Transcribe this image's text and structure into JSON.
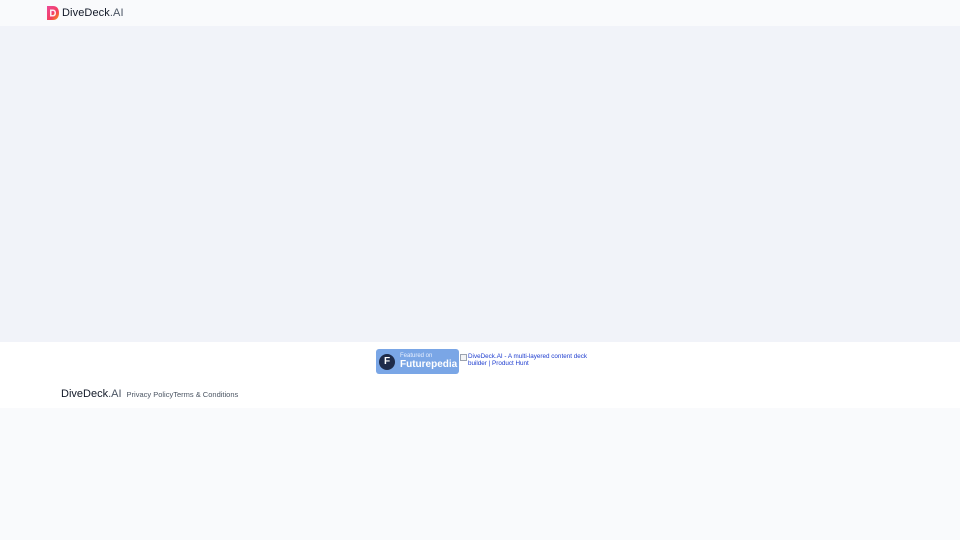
{
  "header": {
    "brand_name": "DiveDeck",
    "brand_suffix": ".AI"
  },
  "footer": {
    "futurepedia_badge": {
      "small_text": "Featured on",
      "big_text": "Futurepedia",
      "icon_letter": "F"
    },
    "product_hunt_badge": {
      "alt_text": "DiveDeck.AI - A multi-layered content deck builder | Product Hunt"
    },
    "brand_name": "DiveDeck",
    "brand_suffix": ".AI",
    "links": {
      "privacy": "Privacy Policy",
      "terms": "Terms & Conditions"
    }
  },
  "colors": {
    "logo_gradient_start": "#f43f5e",
    "logo_gradient_end": "#f59e0b",
    "futurepedia_bg": "#7aa6e6",
    "link_blue": "#1d3ccf"
  }
}
